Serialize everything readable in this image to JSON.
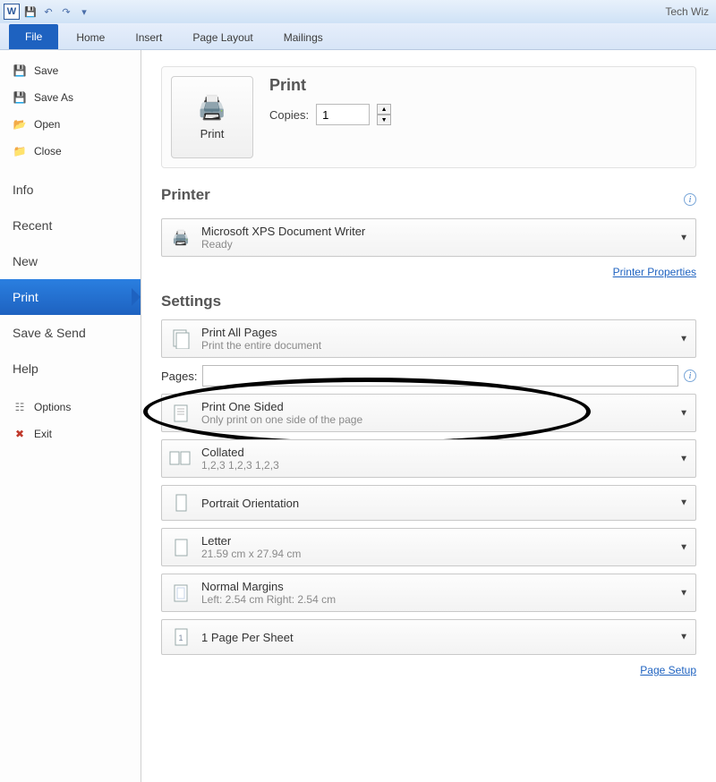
{
  "titlebar": {
    "doc_title": "Tech Wiz"
  },
  "ribbon": {
    "file": "File",
    "tabs": [
      "Home",
      "Insert",
      "Page Layout",
      "Mailings"
    ]
  },
  "sidebar": {
    "save": "Save",
    "save_as": "Save As",
    "open": "Open",
    "close": "Close",
    "info": "Info",
    "recent": "Recent",
    "new": "New",
    "print": "Print",
    "save_send": "Save & Send",
    "help": "Help",
    "options": "Options",
    "exit": "Exit"
  },
  "print": {
    "button_label": "Print",
    "heading": "Print",
    "copies_label": "Copies:",
    "copies_value": "1"
  },
  "printer": {
    "section": "Printer",
    "name": "Microsoft XPS Document Writer",
    "status": "Ready",
    "properties_link": "Printer Properties"
  },
  "settings": {
    "section": "Settings",
    "pages": {
      "title": "Print All Pages",
      "sub": "Print the entire document"
    },
    "pages_label": "Pages:",
    "pages_value": "",
    "sides": {
      "title": "Print One Sided",
      "sub": "Only print on one side of the page"
    },
    "collate": {
      "title": "Collated",
      "sub": "1,2,3    1,2,3    1,2,3"
    },
    "orientation": {
      "title": "Portrait Orientation"
    },
    "size": {
      "title": "Letter",
      "sub": "21.59 cm x 27.94 cm"
    },
    "margins": {
      "title": "Normal Margins",
      "sub": "Left:  2.54 cm    Right:  2.54 cm"
    },
    "sheets": {
      "title": "1 Page Per Sheet"
    },
    "page_setup_link": "Page Setup"
  }
}
